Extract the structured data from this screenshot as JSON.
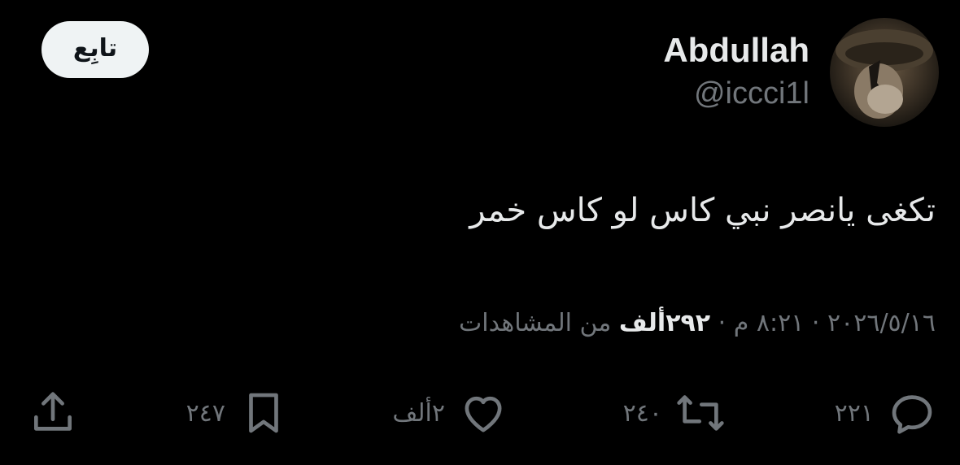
{
  "header": {
    "follow_label": "تابِع",
    "display_name": "Abdullah",
    "handle": "@iccci1l"
  },
  "tweet": {
    "text": "تكغى يانصر نبي كاس لو كاس خمر"
  },
  "meta": {
    "date": "٢٠٢٦/٥/١٦",
    "separator": "·",
    "time": "٨:٢١ م",
    "views_count": "٢٩٢ألف",
    "views_label": "من المشاهدات"
  },
  "actions": {
    "replies": "٢٢١",
    "reposts": "٢٤٠",
    "likes": "٢ألف",
    "bookmarks": "٢٤٧"
  },
  "icons": {
    "reply": "reply-icon",
    "repost": "repost-icon",
    "like": "heart-icon",
    "bookmark": "bookmark-icon",
    "share": "share-icon"
  },
  "colors": {
    "background": "#000000",
    "primary_text": "#e7e9ea",
    "secondary_text": "#71767b",
    "follow_button_bg": "#eff3f4",
    "follow_button_text": "#0f1419"
  }
}
